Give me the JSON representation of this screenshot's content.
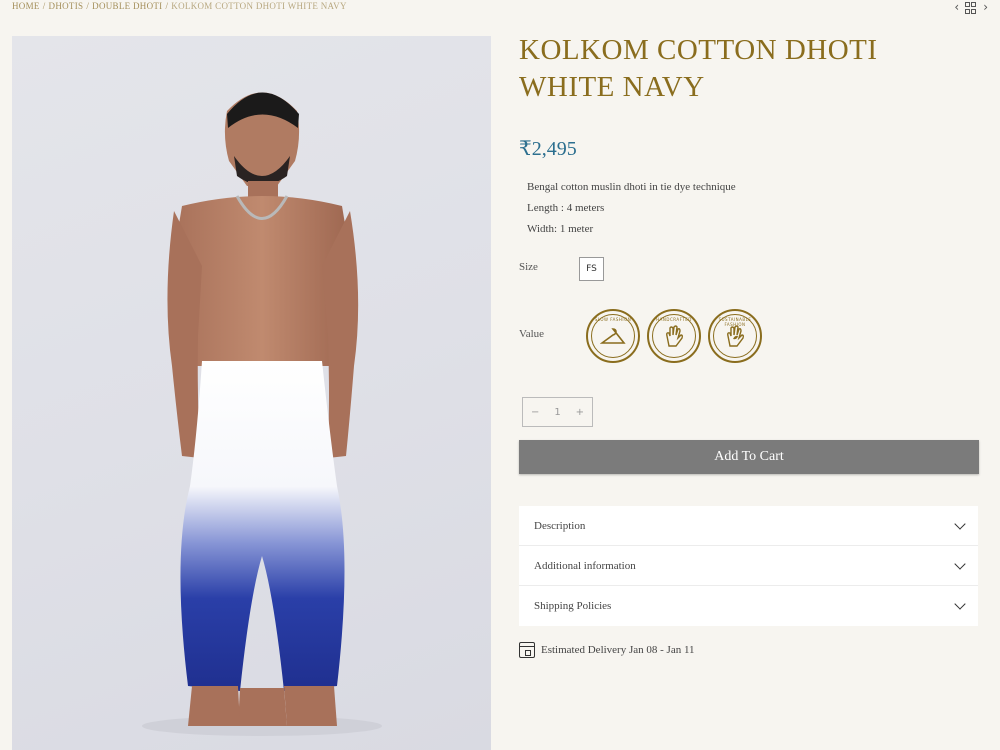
{
  "breadcrumb": {
    "items": [
      "HOME",
      "DHOTIS",
      "DOUBLE DHOTI"
    ],
    "current": "KOLKOM COTTON DHOTI WHITE NAVY",
    "separator": "/"
  },
  "nav": {
    "prev_label": "‹",
    "next_label": "›"
  },
  "product": {
    "title": "KOLKOM COTTON DHOTI WHITE NAVY",
    "price": "₹2,495",
    "description_lines": [
      "Bengal cotton muslin dhoti in tie dye technique",
      "Length : 4 meters",
      "Width: 1 meter"
    ],
    "size_label": "Size",
    "size_value": "FS",
    "value_label": "Value",
    "value_badges": [
      {
        "text": "SLOW FASHION",
        "icon": "hanger-icon"
      },
      {
        "text": "HANDCRAFTED",
        "icon": "hand-icon"
      },
      {
        "text": "SUSTAINABLE FASHION",
        "icon": "hand-leaf-icon"
      }
    ],
    "quantity": {
      "minus": "−",
      "value": "1",
      "plus": "+"
    },
    "add_to_cart": "Add To Cart"
  },
  "accordion": [
    {
      "label": "Description"
    },
    {
      "label": "Additional information"
    },
    {
      "label": "Shipping Policies"
    }
  ],
  "delivery": "Estimated Delivery Jan 08 - Jan 11",
  "colors": {
    "accent_gold": "#8a6d1e",
    "price_blue": "#2c6f8f",
    "cart_gray": "#7b7b7b",
    "background": "#f7f5f0"
  }
}
